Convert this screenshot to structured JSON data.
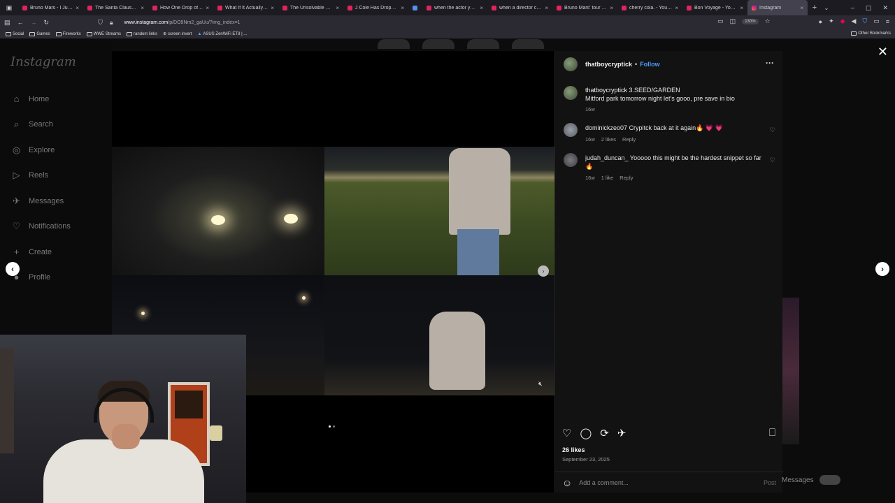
{
  "browser": {
    "tabs": [
      {
        "title": "Bruno Mars - I Just Might"
      },
      {
        "title": "The Santa Clause's \"Accu"
      },
      {
        "title": "How One Drop of Water"
      },
      {
        "title": "What If It Actually Happ"
      },
      {
        "title": "The Unsolvable Mystery"
      },
      {
        "title": "J Cole Has Dropped - Th"
      },
      {
        "title": ""
      },
      {
        "title": "when the actor you hire"
      },
      {
        "title": "when a director colour-"
      },
      {
        "title": "Bruno Mars' tour has th"
      },
      {
        "title": "cherry cola. - YouTube"
      },
      {
        "title": "Bon Voyage - YouTube"
      },
      {
        "title": "Instagram"
      }
    ],
    "url_domain": "www.instagram.com",
    "url_path": "/p/DO9Nm2_gaUu/?img_index=1",
    "zoom": "130%",
    "bookmarks": [
      "Social",
      "Games",
      "Fireworks",
      "WWE Streams",
      "random links",
      "screen invert",
      "ASUS ZenWiFi ET8 | ..."
    ],
    "other_bookmarks": "Other Bookmarks"
  },
  "sidebar": {
    "logo": "Instagram",
    "items": [
      {
        "label": "Home",
        "icon": "⌂"
      },
      {
        "label": "Search",
        "icon": "⌕"
      },
      {
        "label": "Explore",
        "icon": "◎"
      },
      {
        "label": "Reels",
        "icon": "▷"
      },
      {
        "label": "Messages",
        "icon": "✈"
      },
      {
        "label": "Notifications",
        "icon": "♡"
      },
      {
        "label": "Create",
        "icon": "+"
      },
      {
        "label": "Profile",
        "icon": "●"
      }
    ]
  },
  "post": {
    "author": "thatboycryptick",
    "follow_label": "Follow",
    "separator": "•",
    "more": "···",
    "caption_author": "thatboycryptick",
    "caption_title": "3.SEED/GARDEN",
    "caption_text": "Mitford park tomorrow night let's gooo, pre save in bio",
    "caption_age": "16w",
    "comments": [
      {
        "user": "dominickzeo07",
        "text": "Crypitck back at it again🔥 💗 💗",
        "age": "16w",
        "likes": "2 likes",
        "reply": "Reply"
      },
      {
        "user": "judah_duncan_",
        "text": "Yooooo this might be the hardest snippet so far 🔥",
        "age": "16w",
        "likes": "1 like",
        "reply": "Reply"
      }
    ],
    "likes": "26 likes",
    "date": "September 23, 2025",
    "comment_placeholder": "Add a comment...",
    "post_label": "Post",
    "carousel_index": 1,
    "carousel_total": 2
  },
  "floating_messages": "Messages"
}
